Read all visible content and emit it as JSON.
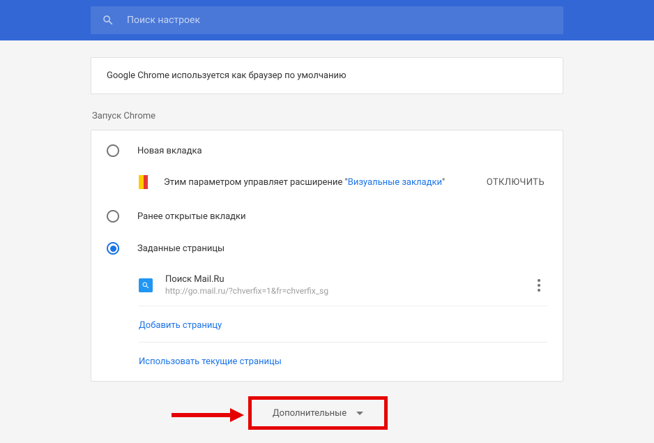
{
  "header": {
    "search_placeholder": "Поиск настроек"
  },
  "default_browser": {
    "message": "Google Chrome используется как браузер по умолчанию"
  },
  "startup": {
    "section_title": "Запуск Chrome",
    "options": {
      "new_tab": "Новая вкладка",
      "continue": "Ранее открытые вкладки",
      "specific": "Заданные страницы"
    },
    "extension_notice": {
      "prefix": "Этим параметром управляет расширение \"",
      "link": "Визуальные закладки",
      "suffix": "\"",
      "disable": "ОТКЛЮЧИТЬ"
    },
    "pages": [
      {
        "title": "Поиск Mail.Ru",
        "url": "http://go.mail.ru/?chverfix=1&fr=chverfix_sg"
      }
    ],
    "add_page": "Добавить страницу",
    "use_current": "Использовать текущие страницы"
  },
  "advanced_button": "Дополнительные"
}
